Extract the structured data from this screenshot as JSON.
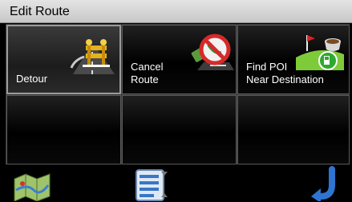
{
  "window": {
    "title": "Edit Route"
  },
  "tiles": [
    {
      "label": "Detour",
      "icon": "detour-icon"
    },
    {
      "label": "Cancel\nRoute",
      "icon": "cancel-route-icon"
    },
    {
      "label": "Find POI\nNear Destination",
      "icon": "poi-near-destination-icon"
    },
    {
      "label": ""
    },
    {
      "label": ""
    },
    {
      "label": ""
    }
  ],
  "bottom_bar": {
    "left_icon": "map-icon",
    "center_icon": "route-list-icon",
    "right_icon": "back-arrow-icon"
  },
  "colors": {
    "titlebar": "#d6d6d6",
    "tile_background": "#000000",
    "label": "#ffffff",
    "back_arrow": "#2f74d0"
  }
}
